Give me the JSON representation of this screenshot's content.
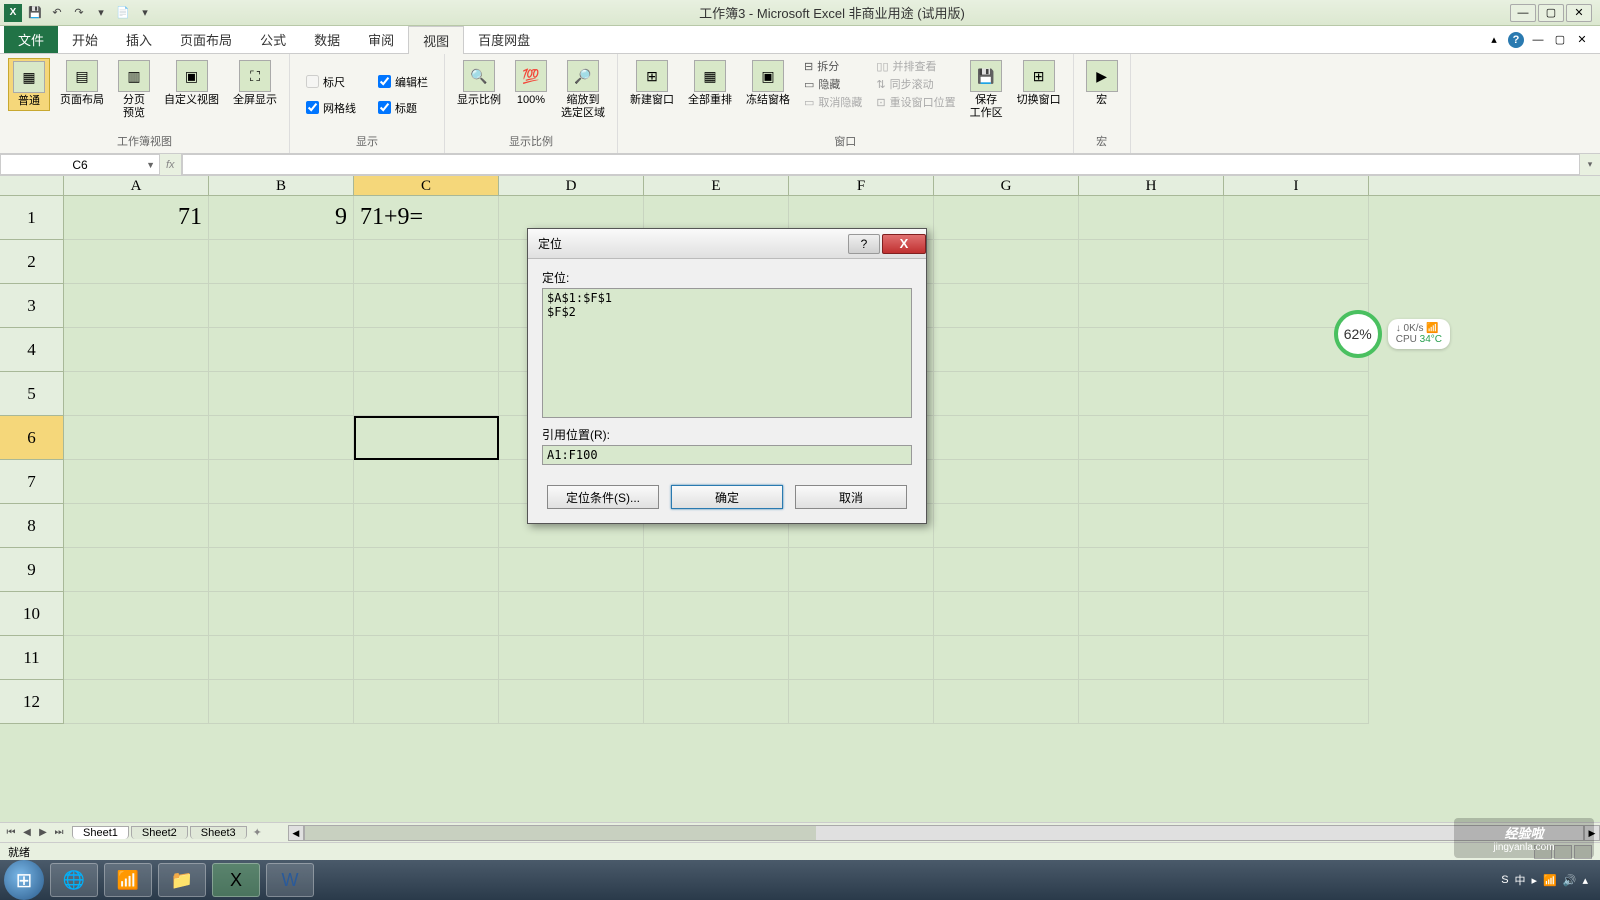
{
  "titlebar": {
    "title": "工作簿3 - Microsoft Excel 非商业用途 (试用版)"
  },
  "tabs": {
    "file": "文件",
    "items": [
      "开始",
      "插入",
      "页面布局",
      "公式",
      "数据",
      "审阅",
      "视图",
      "百度网盘"
    ],
    "active": "视图"
  },
  "ribbon": {
    "g1": {
      "label": "工作簿视图",
      "normal": "普通",
      "pagelayout": "页面布局",
      "pagebreak": "分页\n预览",
      "custom": "自定义视图",
      "fullscreen": "全屏显示"
    },
    "g2": {
      "label": "显示",
      "ruler": "标尺",
      "formula": "编辑栏",
      "grid": "网格线",
      "headings": "标题"
    },
    "g3": {
      "label": "显示比例",
      "zoom": "显示比例",
      "z100": "100%",
      "zoomsel": "缩放到\n选定区域"
    },
    "g4": {
      "label": "窗口",
      "newwin": "新建窗口",
      "arrange": "全部重排",
      "freeze": "冻结窗格",
      "split": "拆分",
      "hide": "隐藏",
      "unhide": "取消隐藏",
      "side": "并排查看",
      "sync": "同步滚动",
      "reset": "重设窗口位置",
      "save": "保存\n工作区",
      "switch": "切换窗口"
    },
    "g5": {
      "label": "宏",
      "macro": "宏"
    }
  },
  "namebox": {
    "value": "C6"
  },
  "columns": [
    "A",
    "B",
    "C",
    "D",
    "E",
    "F",
    "G",
    "H",
    "I"
  ],
  "rows": [
    "1",
    "2",
    "3",
    "4",
    "5",
    "6",
    "7",
    "8",
    "9",
    "10",
    "11",
    "12"
  ],
  "cells": {
    "A1": "71",
    "B1": "9",
    "C1": "71+9="
  },
  "active_cell": "C6",
  "dialog": {
    "title": "定位",
    "goto_label": "定位:",
    "list": "$A$1:$F$1\n$F$2",
    "ref_label": "引用位置(R):",
    "ref_value": "A1:F100",
    "special": "定位条件(S)...",
    "ok": "确定",
    "cancel": "取消"
  },
  "sheets": {
    "tabs": [
      "Sheet1",
      "Sheet2",
      "Sheet3"
    ],
    "active": "Sheet1"
  },
  "status": {
    "ready": "就绪"
  },
  "perf": {
    "pct": "62%",
    "net": "0K/s",
    "cpu": "CPU",
    "temp": "34°C"
  },
  "watermark": {
    "main": "经验啦",
    "sub": "jingyanla.com"
  }
}
